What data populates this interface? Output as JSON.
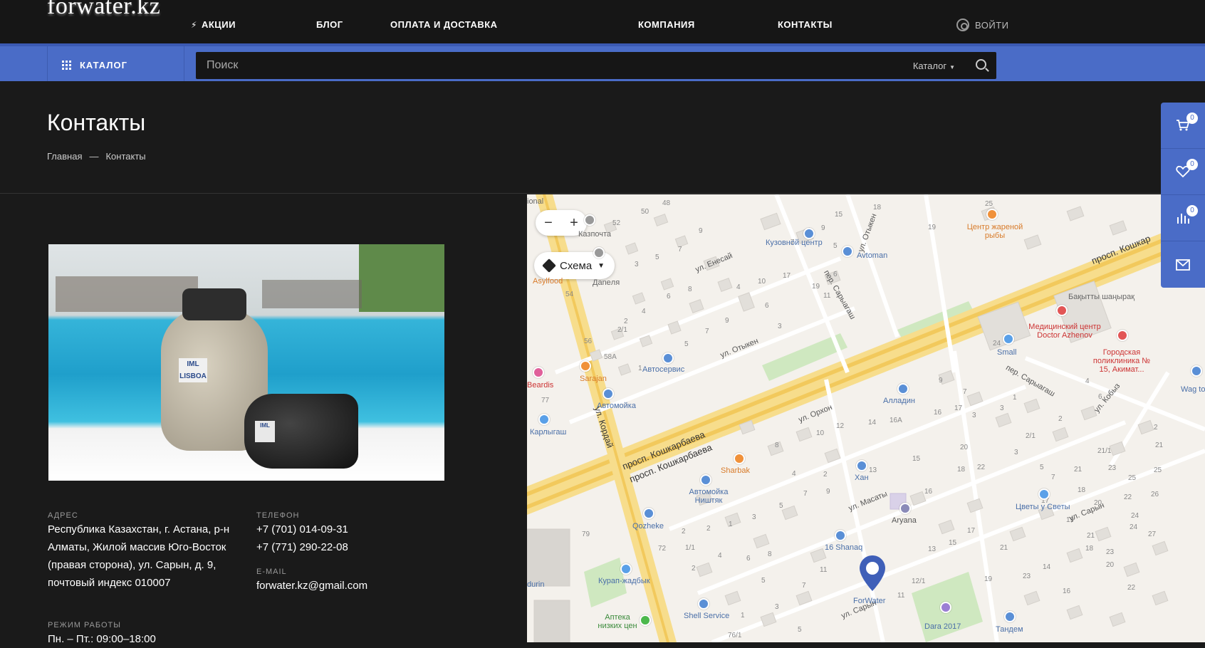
{
  "header": {
    "logo": "forwater.kz",
    "nav": [
      {
        "label": "АКЦИИ"
      },
      {
        "label": "БЛОГ"
      },
      {
        "label": "ОПЛАТА И ДОСТАВКА"
      },
      {
        "label": "КОМПАНИЯ"
      },
      {
        "label": "КОНТАКТЫ"
      }
    ],
    "login_label": "ВОЙТИ"
  },
  "search": {
    "catalog_label": "КАТАЛОГ",
    "placeholder": "Поиск",
    "scope_label": "Каталог"
  },
  "page": {
    "title": "Контакты",
    "breadcrumb": {
      "home": "Главная",
      "sep": "—",
      "current": "Контакты"
    }
  },
  "contacts": {
    "address_label": "АДРЕС",
    "address": "Республика Казахстан, г. Астана, р-н Алматы, Жилой массив Юго-Восток (правая сторона), ул. Сарын, д. 9, почтовый индекс 010007",
    "phone_label": "ТЕЛЕФОН",
    "phones": [
      "+7 (701) 014-09-31",
      "+7 (771) 290-22-08"
    ],
    "email_label": "E-MAIL",
    "email": "forwater.kz@gmail.com",
    "hours_label": "РЕЖИМ РАБОТЫ",
    "hours": "Пн. – Пт.: 09:00–18:00"
  },
  "photo": {
    "tank_label": "IML LISBOA",
    "pump_label": "IML"
  },
  "map": {
    "zoom_out": "−",
    "zoom_in": "+",
    "layer_label": "Схема",
    "marker_label": "ForWater",
    "streets": [
      "просп. Кошкарбаева",
      "просп. Кошкарбаева",
      "ул. Кордай",
      "ул. Отыкен",
      "ул. Енесай",
      "ул. Орхон",
      "ул. Масаты",
      "ул. Сарын",
      "ул. Сарын",
      "пер. Сарыагаш",
      "пер. Сарыагаш",
      "ул. Отыкен",
      "ул. Кобыз",
      "просп. Кошкар"
    ],
    "places": [
      "Кузовной центр",
      "Avtoman",
      "Центр жареной рыбы",
      "Казпочта",
      "Даneля",
      "Asylfood",
      "Бақытты шаңырақ",
      "Медицинский центр Doctor Azhenov",
      "Городская поликлиника № 15, Акимат...",
      "Small",
      "Автосервис",
      "Sarajan",
      "Beardis",
      "Автомойка",
      "Алладин",
      "Карлыгаш",
      "Sharbak",
      "Автомойка Ништяк",
      "Хан",
      "Qozheke",
      "Aryana",
      "Цветы у Светы",
      "16 Shanaq",
      "Курап-жадбык",
      "Shell Service",
      "Аптека низких цен",
      "Dara 2017",
      "Тандем",
      "Wag to",
      "ional",
      "durin"
    ]
  },
  "sidebar": {
    "cart_count": "0",
    "favorites_count": "0",
    "compare_count": "0"
  },
  "colors": {
    "accent": "#4a6cc7",
    "background": "#1a1a1a",
    "topbar": "#161616"
  }
}
